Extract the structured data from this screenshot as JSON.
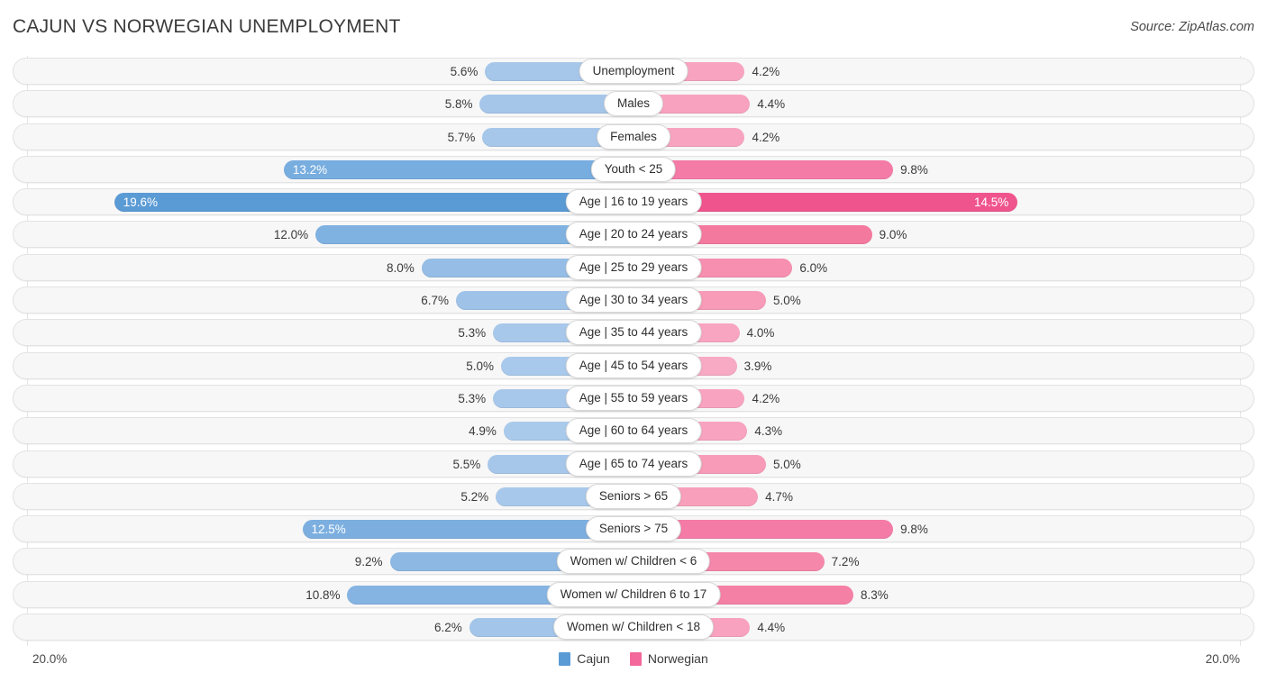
{
  "header": {
    "title": "CAJUN VS NORWEGIAN UNEMPLOYMENT",
    "source": "Source: ZipAtlas.com"
  },
  "footer": {
    "axis_left": "20.0%",
    "axis_right": "20.0%",
    "legend": [
      {
        "label": "Cajun",
        "color": "#5B9BD5"
      },
      {
        "label": "Norwegian",
        "color": "#F4679A"
      }
    ]
  },
  "chart_data": {
    "type": "bar",
    "subtype": "diverging-bidirectional",
    "title": "CAJUN VS NORWEGIAN UNEMPLOYMENT",
    "xlabel": "",
    "ylabel": "",
    "axis_max_percent": 20.0,
    "axis_left_label": "20.0%",
    "axis_right_label": "20.0%",
    "grid": false,
    "legend_position": "bottom-center",
    "categories": [
      "Unemployment",
      "Males",
      "Females",
      "Youth < 25",
      "Age | 16 to 19 years",
      "Age | 20 to 24 years",
      "Age | 25 to 29 years",
      "Age | 30 to 34 years",
      "Age | 35 to 44 years",
      "Age | 45 to 54 years",
      "Age | 55 to 59 years",
      "Age | 60 to 64 years",
      "Age | 65 to 74 years",
      "Seniors > 65",
      "Seniors > 75",
      "Women w/ Children < 6",
      "Women w/ Children 6 to 17",
      "Women w/ Children < 18"
    ],
    "series": [
      {
        "name": "Cajun",
        "color": "#5B9BD5",
        "direction": "left",
        "values": [
          5.6,
          5.8,
          5.7,
          13.2,
          19.6,
          12.0,
          8.0,
          6.7,
          5.3,
          5.0,
          5.3,
          4.9,
          5.5,
          5.2,
          12.5,
          9.2,
          10.8,
          6.2
        ]
      },
      {
        "name": "Norwegian",
        "color": "#F4679A",
        "direction": "right",
        "values": [
          4.2,
          4.4,
          4.2,
          9.8,
          14.5,
          9.0,
          6.0,
          5.0,
          4.0,
          3.9,
          4.2,
          4.3,
          5.0,
          4.7,
          9.8,
          7.2,
          8.3,
          4.4
        ]
      }
    ]
  },
  "rows": [
    {
      "label": "Unemployment",
      "left_value": "5.6%",
      "right_value": "4.2%",
      "left_pct": 5.6,
      "right_pct": 4.2,
      "left_color": "#A6C7EA",
      "right_color": "#F8A4C0",
      "left_inside": false,
      "right_inside": false
    },
    {
      "label": "Males",
      "left_value": "5.8%",
      "right_value": "4.4%",
      "left_pct": 5.8,
      "right_pct": 4.4,
      "left_color": "#A5C6E9",
      "right_color": "#F8A2BF",
      "left_inside": false,
      "right_inside": false
    },
    {
      "label": "Females",
      "left_value": "5.7%",
      "right_value": "4.2%",
      "left_pct": 5.7,
      "right_pct": 4.2,
      "left_color": "#A6C7EA",
      "right_color": "#F8A4C0",
      "left_inside": false,
      "right_inside": false
    },
    {
      "label": "Youth < 25",
      "left_value": "13.2%",
      "right_value": "9.8%",
      "left_pct": 13.2,
      "right_pct": 9.8,
      "left_color": "#78ADDF",
      "right_color": "#F47BA6",
      "left_inside": true,
      "right_inside": false
    },
    {
      "label": "Age | 16 to 19 years",
      "left_value": "19.6%",
      "right_value": "14.5%",
      "left_pct": 19.6,
      "right_pct": 14.5,
      "left_color": "#5B9BD5",
      "right_color": "#F0548D",
      "left_inside": true,
      "right_inside": true
    },
    {
      "label": "Age | 20 to 24 years",
      "left_value": "12.0%",
      "right_value": "9.0%",
      "left_pct": 12.0,
      "right_pct": 9.0,
      "left_color": "#7FB1E1",
      "right_color": "#F4799F",
      "left_inside": false,
      "right_inside": false
    },
    {
      "label": "Age | 25 to 29 years",
      "left_value": "8.0%",
      "right_value": "6.0%",
      "left_pct": 8.0,
      "right_pct": 6.0,
      "left_color": "#95BDE5",
      "right_color": "#F68FB0",
      "left_inside": false,
      "right_inside": false
    },
    {
      "label": "Age | 30 to 34 years",
      "left_value": "6.7%",
      "right_value": "5.0%",
      "left_pct": 6.7,
      "right_pct": 5.0,
      "left_color": "#9FC2E8",
      "right_color": "#F79BB8",
      "left_inside": false,
      "right_inside": false
    },
    {
      "label": "Age | 35 to 44 years",
      "left_value": "5.3%",
      "right_value": "4.0%",
      "left_pct": 5.3,
      "right_pct": 4.0,
      "left_color": "#A8C8EB",
      "right_color": "#F8A5C1",
      "left_inside": false,
      "right_inside": false
    },
    {
      "label": "Age | 45 to 54 years",
      "left_value": "5.0%",
      "right_value": "3.9%",
      "left_pct": 5.0,
      "right_pct": 3.9,
      "left_color": "#A9C9EC",
      "right_color": "#F8A9C4",
      "left_inside": false,
      "right_inside": false
    },
    {
      "label": "Age | 55 to 59 years",
      "left_value": "5.3%",
      "right_value": "4.2%",
      "left_pct": 5.3,
      "right_pct": 4.2,
      "left_color": "#A8C8EB",
      "right_color": "#F8A4C0",
      "left_inside": false,
      "right_inside": false
    },
    {
      "label": "Age | 60 to 64 years",
      "left_value": "4.9%",
      "right_value": "4.3%",
      "left_pct": 4.9,
      "right_pct": 4.3,
      "left_color": "#AACAEC",
      "right_color": "#F8A3C0",
      "left_inside": false,
      "right_inside": false
    },
    {
      "label": "Age | 65 to 74 years",
      "left_value": "5.5%",
      "right_value": "5.0%",
      "left_pct": 5.5,
      "right_pct": 5.0,
      "left_color": "#A7C7EA",
      "right_color": "#F79BB8",
      "left_inside": false,
      "right_inside": false
    },
    {
      "label": "Seniors > 65",
      "left_value": "5.2%",
      "right_value": "4.7%",
      "left_pct": 5.2,
      "right_pct": 4.7,
      "left_color": "#A8C8EB",
      "right_color": "#F79FBB",
      "left_inside": false,
      "right_inside": false
    },
    {
      "label": "Seniors > 75",
      "left_value": "12.5%",
      "right_value": "9.8%",
      "left_pct": 12.5,
      "right_pct": 9.8,
      "left_color": "#7CAFE0",
      "right_color": "#F47BA6",
      "left_inside": true,
      "right_inside": false
    },
    {
      "label": "Women w/ Children < 6",
      "left_value": "9.2%",
      "right_value": "7.2%",
      "left_pct": 9.2,
      "right_pct": 7.2,
      "left_color": "#8DB8E3",
      "right_color": "#F587AB",
      "left_inside": false,
      "right_inside": false
    },
    {
      "label": "Women w/ Children 6 to 17",
      "left_value": "10.8%",
      "right_value": "8.3%",
      "left_pct": 10.8,
      "right_pct": 8.3,
      "left_color": "#85B4E2",
      "right_color": "#F580A6",
      "left_inside": false,
      "right_inside": false
    },
    {
      "label": "Women w/ Children < 18",
      "left_value": "6.2%",
      "right_value": "4.4%",
      "left_pct": 6.2,
      "right_pct": 4.4,
      "left_color": "#A3C5E9",
      "right_color": "#F8A2BF",
      "left_inside": false,
      "right_inside": false
    }
  ]
}
